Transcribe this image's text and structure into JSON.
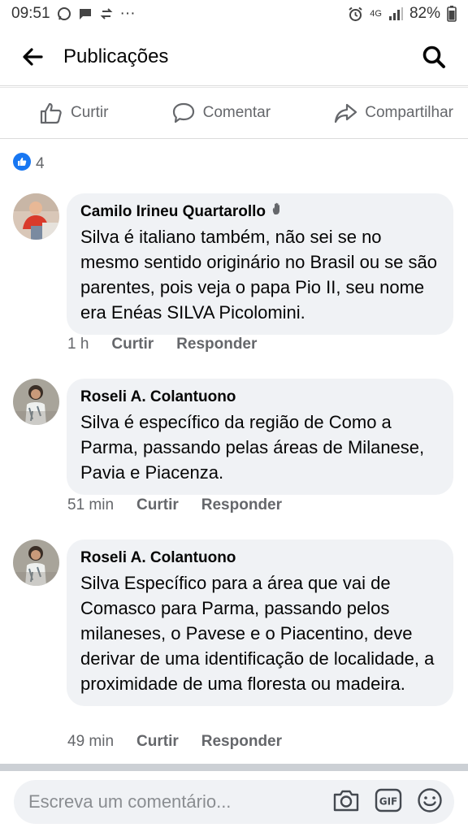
{
  "status_bar": {
    "time": "09:51",
    "more": "···",
    "network": "4G",
    "battery": "82%"
  },
  "header": {
    "title": "Publicações"
  },
  "actions": {
    "like": "Curtir",
    "comment": "Comentar",
    "share": "Compartilhar"
  },
  "reactions": {
    "count": "4"
  },
  "comments": [
    {
      "author": "Camilo Irineu Quartarollo",
      "text": "Silva é italiano também, não sei se no mesmo sentido originário no Brasil ou se são parentes, pois veja o papa Pio II, seu nome era Enéas SILVA Picolomini.",
      "time": "1 h",
      "like": "Curtir",
      "reply": "Responder"
    },
    {
      "author": "Roseli A. Colantuono",
      "text": "Silva é específico da região de Como a Parma, passando pelas áreas de Milanese, Pavia e Piacenza.",
      "time": "51 min",
      "like": "Curtir",
      "reply": "Responder"
    },
    {
      "author": "Roseli A. Colantuono",
      "text": "Silva Específico para a área que vai de Comasco para Parma, passando pelos milaneses, o Pavese e o Piacentino, deve derivar de uma identificação de localidade, a proximidade de uma floresta ou madeira.",
      "time": "49 min",
      "like": "Curtir",
      "reply": "Responder"
    }
  ],
  "composer": {
    "placeholder": "Escreva um comentário..."
  },
  "colors": {
    "accent": "#1877f2",
    "bubble": "#f0f2f5",
    "muted": "#65676b"
  }
}
